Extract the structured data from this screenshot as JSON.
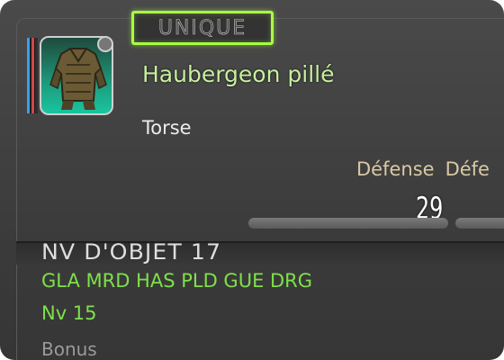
{
  "tooltip": {
    "rarity_tag": "UNIQUE",
    "item_name": "Haubergeon pillé",
    "slot": "Torse",
    "stats": {
      "labels": [
        "Défense",
        "Défe"
      ],
      "value": "29"
    },
    "item_level": "NV D'OBJET 17",
    "classes": "GLA MRD HAS PLD GUE DRG",
    "required_level": "Nv 15",
    "bonus_heading": "Bonus"
  },
  "colors": {
    "unique_border": "#a8ff42",
    "item_name": "#c8f0a0",
    "class_text": "#7ee04a",
    "stat_label": "#d9c9a4",
    "icon_bg": "#1e9a7c"
  },
  "icons": {
    "item": "chest-armor-icon",
    "rarity": "rarity-stripe-icon"
  }
}
